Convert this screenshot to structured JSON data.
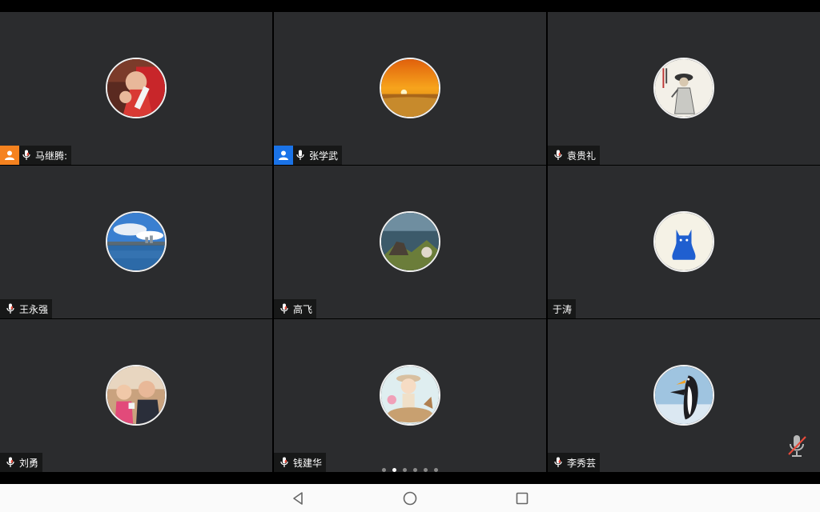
{
  "participants": [
    {
      "name": "马继腾:",
      "host_badge": "orange",
      "mic": "normal",
      "avatar": "boy-red-shirt-photo"
    },
    {
      "name": "张学武",
      "host_badge": "blue",
      "mic": "normal",
      "avatar": "sunset-field-photo"
    },
    {
      "name": "袁贵礼",
      "host_badge": null,
      "mic": "normal",
      "avatar": "ink-painting-scholar"
    },
    {
      "name": "王永强",
      "host_badge": null,
      "mic": "normal",
      "avatar": "lake-sky-photo"
    },
    {
      "name": "高飞",
      "host_badge": null,
      "mic": "normal",
      "avatar": "wolf-artwork"
    },
    {
      "name": "于涛",
      "host_badge": null,
      "mic": null,
      "avatar": "blue-cat-logo"
    },
    {
      "name": "刘勇",
      "host_badge": null,
      "mic": "normal",
      "avatar": "two-kids-photo"
    },
    {
      "name": "钱建华",
      "host_badge": null,
      "mic": "normal",
      "avatar": "cartoon-boy-on-animal"
    },
    {
      "name": "李秀芸",
      "host_badge": null,
      "mic": "normal",
      "avatar": "penguin-photo"
    }
  ],
  "pager": {
    "total": 6,
    "active_index": 1
  },
  "colors": {
    "tile_bg": "#2b2c2e",
    "host_orange": "#f5821f",
    "host_blue": "#1a73e8",
    "mic_red": "#e84a3a"
  },
  "navbar": {
    "buttons": [
      "back-icon",
      "home-icon",
      "recents-icon"
    ]
  }
}
